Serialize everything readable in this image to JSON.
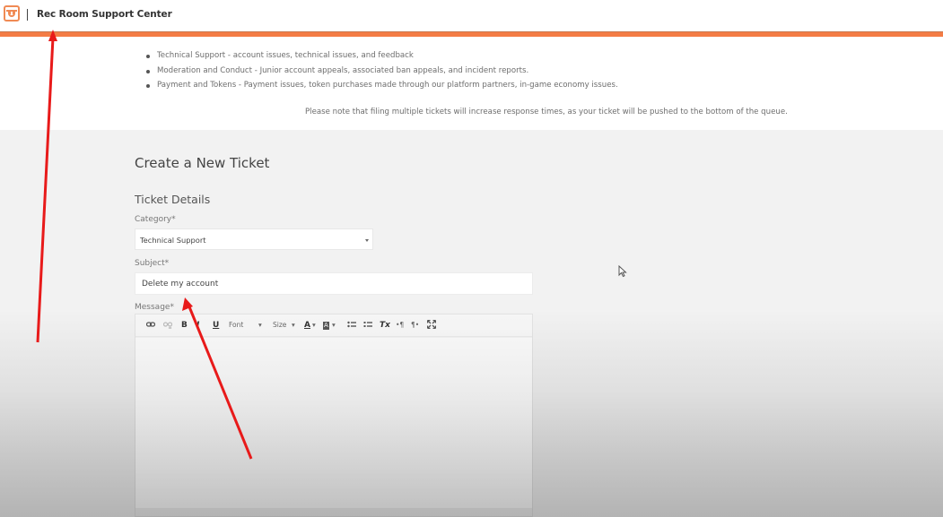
{
  "header": {
    "logo_icon": "rec-room-logo-icon",
    "title": "Rec Room Support Center",
    "accent_color": "#f47c45"
  },
  "info": {
    "categories": [
      "Technical Support - account issues, technical issues, and feedback",
      "Moderation and Conduct - Junior account appeals, associated ban appeals, and incident reports.",
      "Payment and Tokens - Payment issues, token purchases made through our platform partners,  in-game economy issues."
    ],
    "notice": "Please note that filing multiple tickets will increase response times, as your ticket will be pushed to the bottom of the queue."
  },
  "form": {
    "heading": "Create a New Ticket",
    "section": "Ticket Details",
    "category_label": "Category*",
    "category_value": "Technical Support",
    "subject_label": "Subject*",
    "subject_value": "Delete my account",
    "message_label": "Message*",
    "message_value": "",
    "toolbar": {
      "link_icon": "link-icon",
      "unlink_icon": "unlink-icon",
      "bold": "B",
      "italic": "I",
      "underline": "U",
      "font": "Font",
      "size": "Size",
      "text_color": "A",
      "bg_color": "A",
      "dropdown": "▾",
      "bulleted_list_icon": "bulleted-list-icon",
      "numbered_list_icon": "numbered-list-icon",
      "clear_format": "Tx",
      "ltr": "•¶",
      "rtl": "¶•",
      "maximize_icon": "maximize-icon"
    }
  },
  "annotations": {
    "arrow_color": "#e81a1a"
  }
}
